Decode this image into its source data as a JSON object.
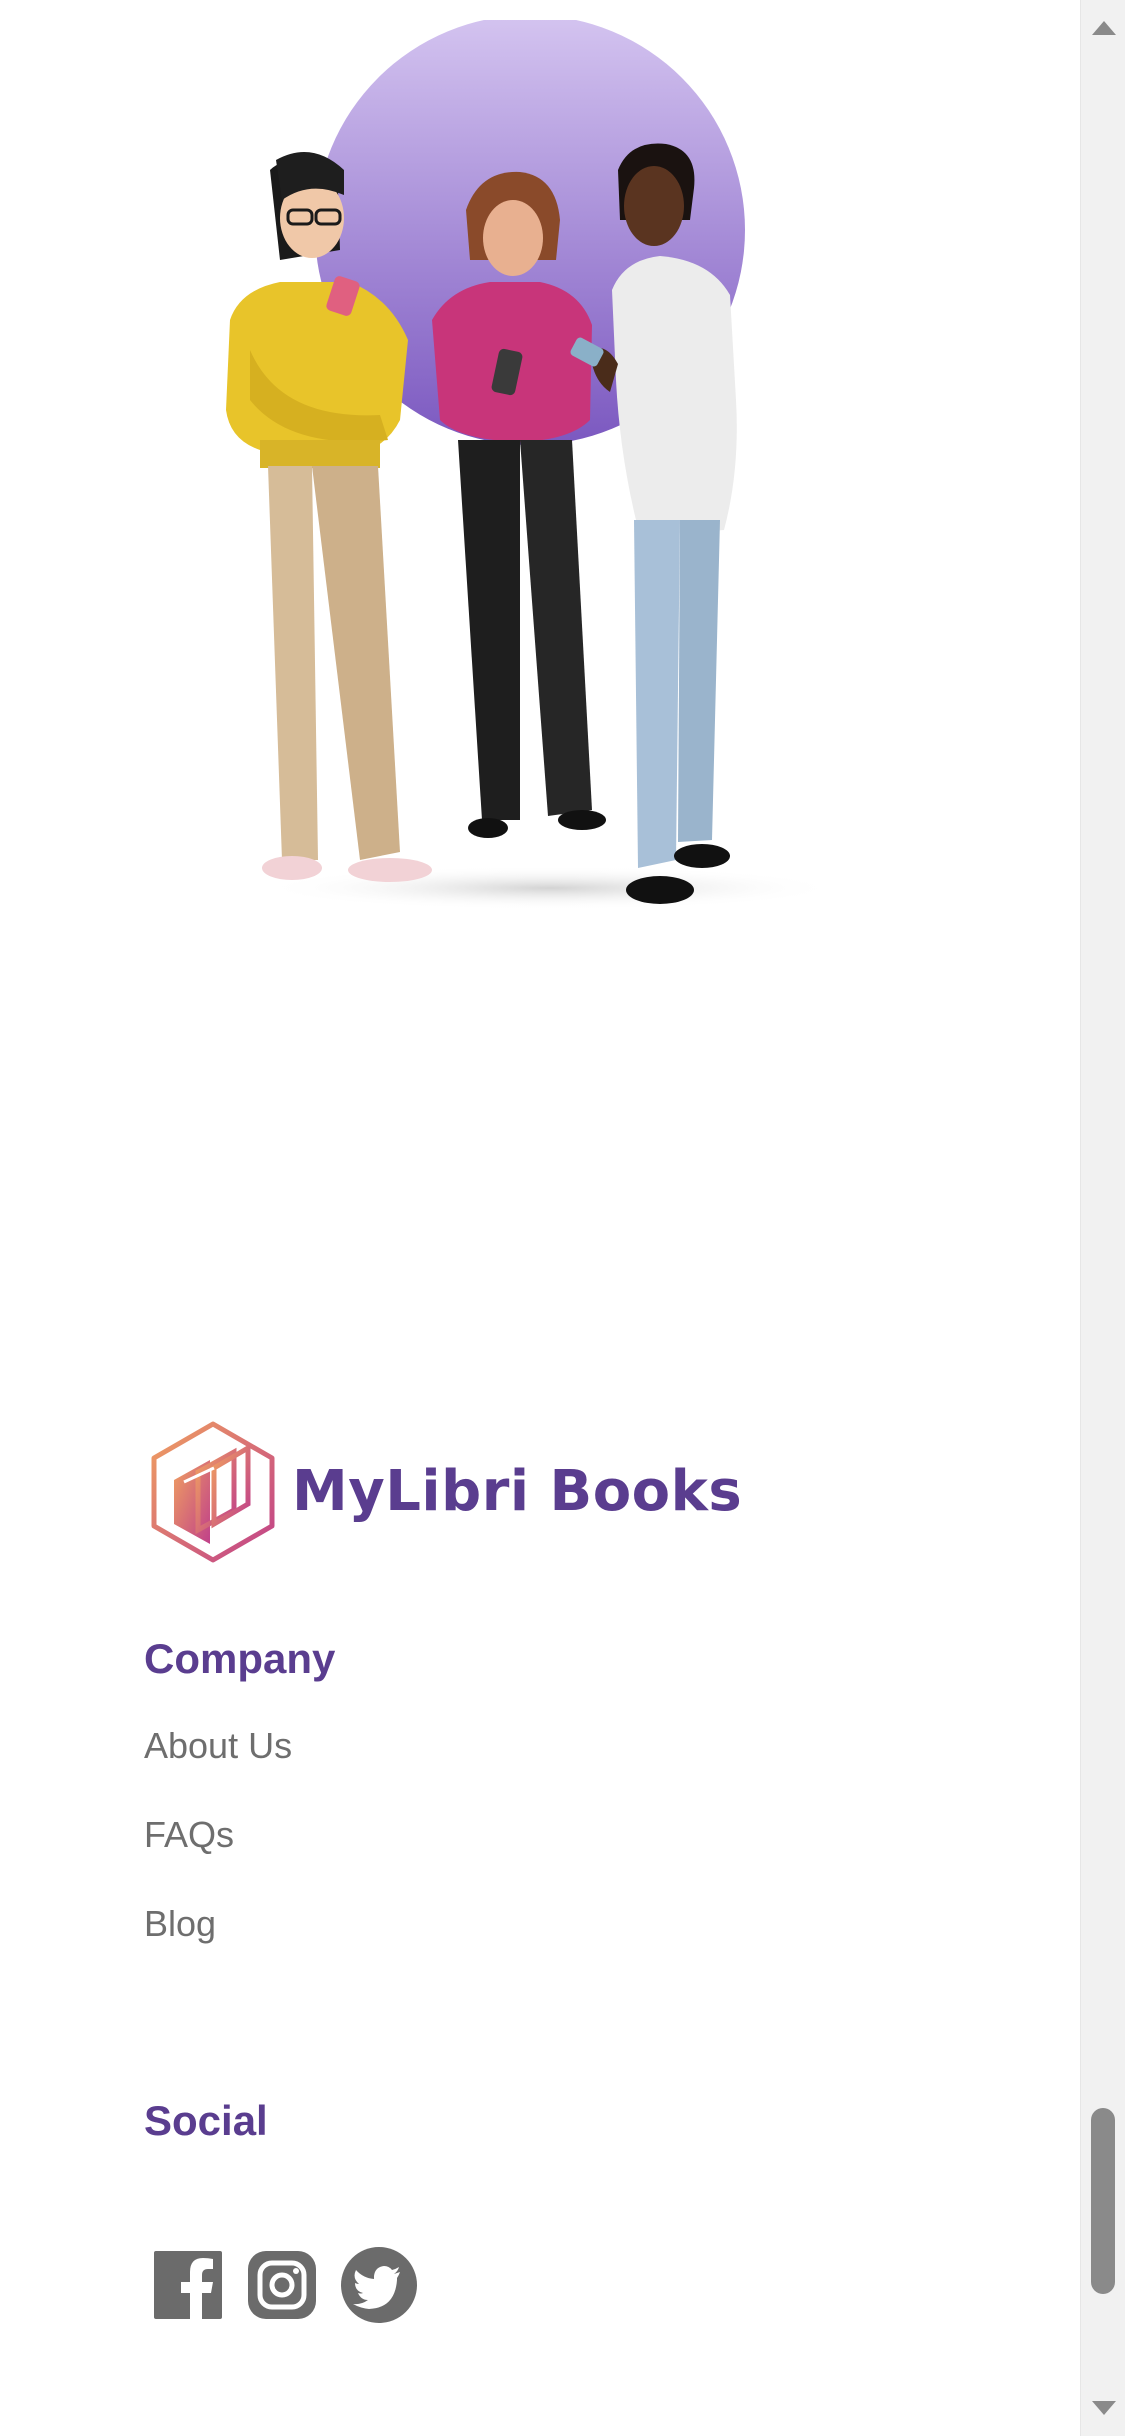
{
  "brand": {
    "name": "MyLibri Books",
    "primary_color": "#5a3d8f",
    "logo_gradient": [
      "#f0a060",
      "#c0408a"
    ]
  },
  "hero": {
    "illustration": "three-people-looking-at-phones",
    "circle_color": "#8b6fc9"
  },
  "footer": {
    "company": {
      "heading": "Company",
      "links": [
        {
          "label": "About Us"
        },
        {
          "label": "FAQs"
        },
        {
          "label": "Blog"
        }
      ]
    },
    "social": {
      "heading": "Social",
      "icons": [
        {
          "icon": "facebook-icon"
        },
        {
          "icon": "instagram-icon"
        },
        {
          "icon": "twitter-icon"
        }
      ],
      "icon_color": "#6b6b6b"
    }
  },
  "scrollbar": {
    "position": "near-bottom"
  }
}
